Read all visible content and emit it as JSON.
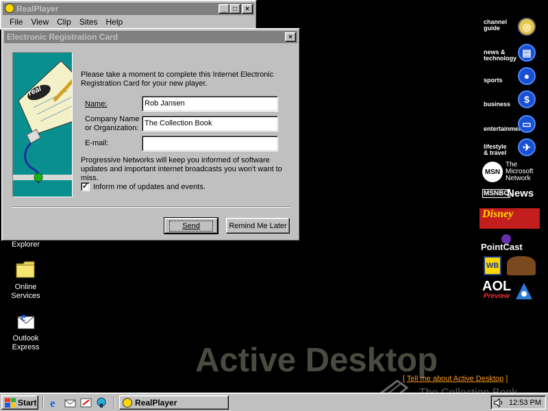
{
  "realplayer": {
    "title": "RealPlayer",
    "menu": [
      "File",
      "View",
      "Clip",
      "Sites",
      "Help"
    ],
    "minimize_glyph": "_",
    "maximize_glyph": "□",
    "close_glyph": "×"
  },
  "dialog": {
    "title": "Electronic Registration Card",
    "close_glyph": "×",
    "intro": "Please take a moment to complete this Internet Electronic Registration Card for your new player.",
    "name_label": "Name:",
    "name_value": "Rob Jansen",
    "company_label_1": "Company Name",
    "company_label_2": "or Organization:",
    "company_value": "The Collection Book",
    "email_label": "E-mail:",
    "email_value": "",
    "note": "Progressive Networks will keep you informed of software updates and important internet broadcasts you won't want to miss.",
    "checkbox_checked": true,
    "checkbox_mark": "✓",
    "checkbox_label": "Inform me of updates and events.",
    "send_label": "Send",
    "later_label": "Remind Me Later",
    "art_logo": "real"
  },
  "desktop": {
    "icons": [
      {
        "label_1": "Explorer",
        "label_2": ""
      },
      {
        "label_1": "Online",
        "label_2": "Services"
      },
      {
        "label_1": "Outlook",
        "label_2": "Express"
      }
    ],
    "channels": [
      {
        "line_1": "channel",
        "line_2": "guide",
        "icon": "magnifier-icon"
      },
      {
        "line_1": "news &",
        "line_2": "technology",
        "icon": "newspaper-icon"
      },
      {
        "line_1": "sports",
        "line_2": "",
        "icon": "ball-icon"
      },
      {
        "line_1": "business",
        "line_2": "",
        "icon": "dollar-icon"
      },
      {
        "line_1": "entertainment",
        "line_2": "",
        "icon": "tv-icon"
      },
      {
        "line_1": "lifestyle",
        "line_2": "& travel",
        "icon": "airplane-icon"
      },
      {
        "line_1": "The",
        "line_2": "Microsoft",
        "line_3": "Network",
        "logo": "MSN"
      },
      {
        "text": "News",
        "logo": "MSNBC"
      },
      {
        "text": "Disney"
      },
      {
        "text": "PointCast"
      },
      {
        "text": "WB"
      },
      {
        "text": "AOL",
        "sub": "Preview"
      }
    ],
    "active_desktop_text": "Active Desktop",
    "tell_me_open": "[ ",
    "tell_me_link": "Tell me about Active Desktop",
    "tell_me_close": " ]",
    "watermark": "The Collection Book"
  },
  "taskbar": {
    "start_label": "Start",
    "task_label": "RealPlayer",
    "clock": "12:53 PM"
  },
  "colors": {
    "desktop": "#000000",
    "face": "#c0c0c0",
    "inactive_title": "#808080",
    "link_orange": "#ff9b1a",
    "art_teal": "#0a8f8f"
  }
}
